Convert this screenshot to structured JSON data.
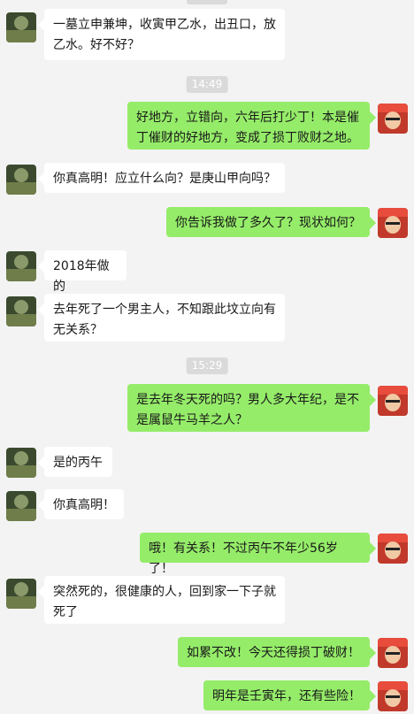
{
  "messages": [
    {
      "side": "left",
      "text": "一墓立申兼坤，收寅甲乙水，出丑口，放乙水。好不好？"
    },
    {
      "time": "14:49"
    },
    {
      "side": "right",
      "text": "好地方，立错向，六年后打少丁！本是催丁催财的好地方，变成了损丁败财之地。"
    },
    {
      "side": "left",
      "text": "你真高明！应立什么向？是庚山甲向吗？"
    },
    {
      "side": "right",
      "text": "你告诉我做了多久了？现状如何？"
    },
    {
      "side": "left",
      "text": "2018年做的"
    },
    {
      "side": "left",
      "text": "去年死了一个男主人，不知跟此坟立向有无关系？"
    },
    {
      "time": "15:29"
    },
    {
      "side": "right",
      "text": "是去年冬天死的吗？男人多大年纪，是不是属鼠牛马羊之人？"
    },
    {
      "side": "left",
      "text": "是的丙午"
    },
    {
      "side": "left",
      "text": "你真高明！"
    },
    {
      "side": "right",
      "text": "哦！有关系！不过丙午不年少56岁了！"
    },
    {
      "side": "left",
      "text": "突然死的，很健康的人，回到家一下子就死了"
    },
    {
      "side": "right",
      "text": "如累不改！今天还得损丁破财！"
    },
    {
      "side": "right",
      "text": "明年是壬寅年，还有些险！"
    }
  ]
}
